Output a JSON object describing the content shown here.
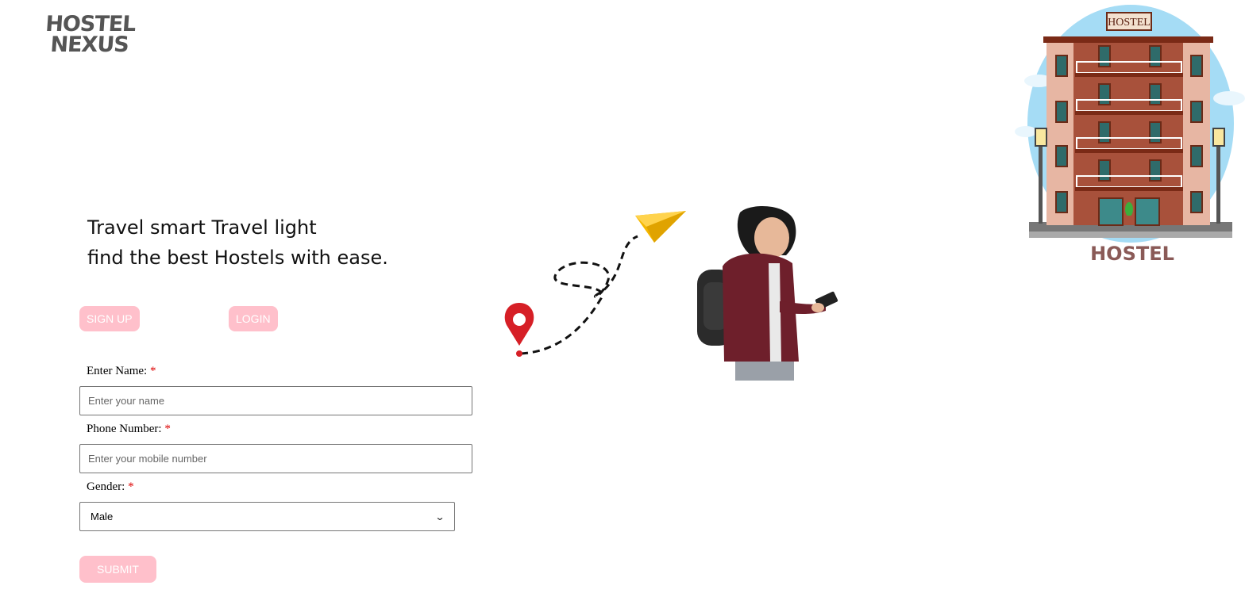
{
  "brand": {
    "line1": "HOSTEL",
    "line2": "NEXUS"
  },
  "hero": {
    "line1": "Travel smart Travel light",
    "line2": "find the best Hostels with ease."
  },
  "nav": {
    "signup_label": "SIGN UP",
    "login_label": "LOGIN"
  },
  "form": {
    "name_label": "Enter Name:",
    "name_placeholder": "Enter your name",
    "phone_label": "Phone Number:",
    "phone_placeholder": "Enter your mobile number",
    "gender_label": "Gender:",
    "gender_value": "Male",
    "required_mark": "*",
    "submit_label": "SUBMIT"
  },
  "hostel_art": {
    "sign_text": "HOSTEL",
    "caption": "HOSTEL"
  },
  "icons": [
    "map-pin-icon",
    "paper-plane-icon",
    "chevron-down-icon"
  ],
  "colors": {
    "button_pink": "#ffc0cb",
    "required_red": "#dd0000",
    "brick": "#a8513b"
  }
}
